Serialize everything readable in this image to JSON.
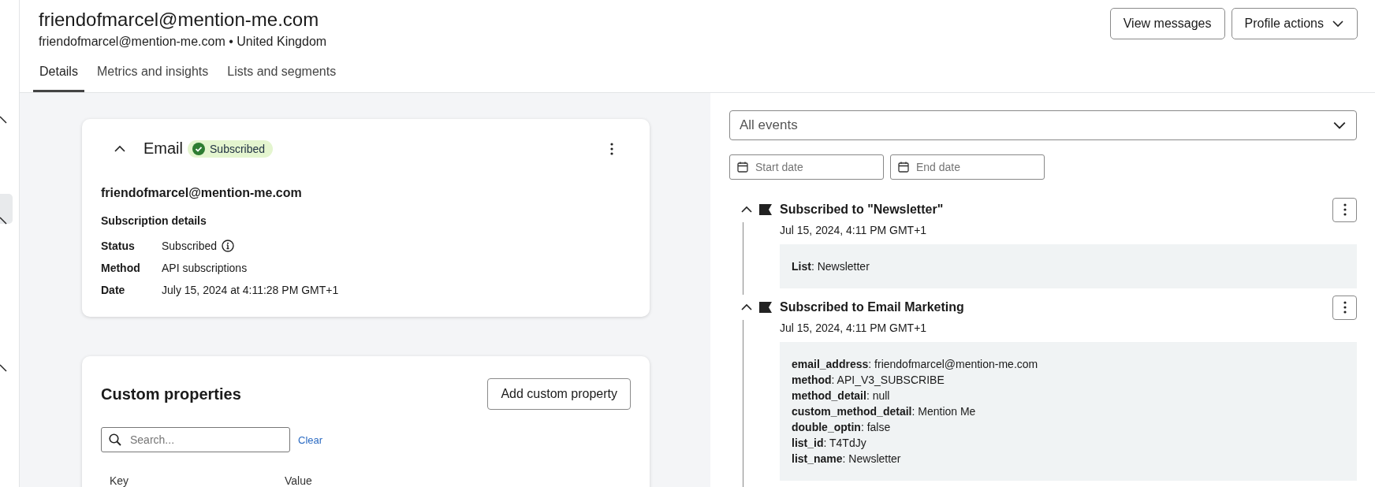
{
  "header": {
    "title": "friendofmarcel@mention-me.com",
    "subtitle": "friendofmarcel@mention-me.com • United Kingdom",
    "buttons": [
      {
        "label": "View messages",
        "kind": "plain"
      },
      {
        "label": "Profile actions",
        "kind": "dropdown"
      }
    ]
  },
  "tabs": [
    {
      "label": "Details",
      "selected": true
    },
    {
      "label": "Metrics and insights",
      "selected": false
    },
    {
      "label": "Lists and segments",
      "selected": false
    }
  ],
  "email_card": {
    "title": "Email",
    "expanded": true,
    "badge": "Subscribed",
    "email": "friendofmarcel@mention-me.com",
    "section_title": "Subscription details",
    "details": [
      {
        "label": "Status",
        "value": "Subscribed",
        "info": true
      },
      {
        "label": "Method",
        "value": "API subscriptions",
        "info": false
      },
      {
        "label": "Date",
        "value": "July 15, 2024 at 4:11:28 PM GMT+1",
        "info": false
      }
    ]
  },
  "custom_properties": {
    "title": "Custom properties",
    "button": "Add custom property",
    "search_placeholder": "Search...",
    "clear": "Clear",
    "columns": [
      "Key",
      "Value"
    ]
  },
  "filters": {
    "events": "All events",
    "start_date_placeholder": "Start date",
    "end_date_placeholder": "End date"
  },
  "events": [
    {
      "title": "Subscribed to \"Newsletter\"",
      "time": "Jul 15, 2024, 4:11 PM GMT+1",
      "expanded": true,
      "properties": [
        "**List**: Newsletter"
      ]
    },
    {
      "title": "Subscribed to Email Marketing",
      "time": "Jul 15, 2024, 4:11 PM GMT+1",
      "expanded": true,
      "properties": [
        "**email_address**: friendofmarcel@mention-me.com",
        "**method**: API_V3_SUBSCRIBE",
        "**method_detail**: null",
        "**custom_method_detail**: Mention Me",
        "**double_optin**: false",
        "**list_id**: T4TdJy",
        "**list_name**: Newsletter"
      ]
    }
  ]
}
